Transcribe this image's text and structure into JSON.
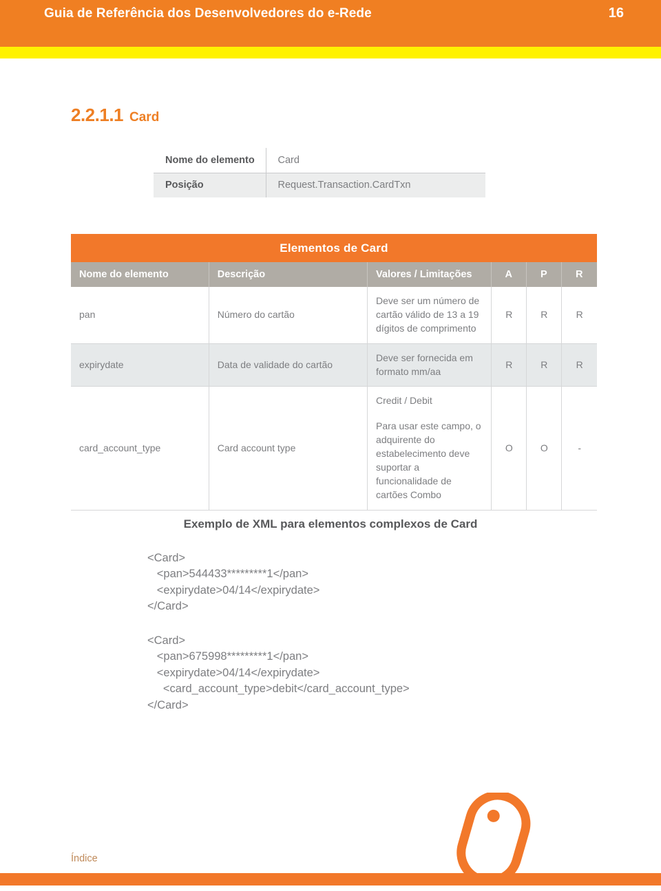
{
  "header": {
    "title": "Guia de Referência dos Desenvolvedores do e-Rede",
    "page_number": "16",
    "bg_color": "#f07f22",
    "stripe_color": "#fff200"
  },
  "section": {
    "number": "2.2.1.1",
    "name": "Card",
    "accent_color": "#ee7f24"
  },
  "info_table": {
    "rows": [
      {
        "key": "Nome do elemento",
        "value": "Card"
      },
      {
        "key": "Posição",
        "value": "Request.Transaction.CardTxn"
      }
    ]
  },
  "elements_table": {
    "caption": "Elementos de Card",
    "columns": [
      "Nome do elemento",
      "Descrição",
      "Valores / Limitações",
      "A",
      "P",
      "R"
    ],
    "rows": [
      {
        "name": "pan",
        "description": "Número do cartão",
        "values": [
          "Deve ser um número de cartão válido de 13 a 19 dígitos de comprimento"
        ],
        "a": "R",
        "p": "R",
        "r": "R"
      },
      {
        "name": "expirydate",
        "description": "Data de validade do cartão",
        "values": [
          "Deve ser fornecida em formato mm/aa"
        ],
        "a": "R",
        "p": "R",
        "r": "R"
      },
      {
        "name": "card_account_type",
        "description": "Card account type",
        "values": [
          "Credit / Debit",
          "Para usar este campo, o adquirente do estabelecimento deve suportar a funcionalidade de cartões Combo"
        ],
        "a": "O",
        "p": "O",
        "r": "-"
      }
    ]
  },
  "xml_example": {
    "title": "Exemplo de XML para elementos complexos de Card",
    "block_1": "<Card>\n   <pan>544433*********1</pan>\n   <expirydate>04/14</expirydate>\n</Card>",
    "block_2": "<Card>\n   <pan>675998*********1</pan>\n   <expirydate>04/14</expirydate>\n     <card_account_type>debit</card_account_type>\n</Card>"
  },
  "footer": {
    "index_label": "Índice",
    "bar_color": "#f2782a",
    "logo_color": "#f2782a"
  }
}
